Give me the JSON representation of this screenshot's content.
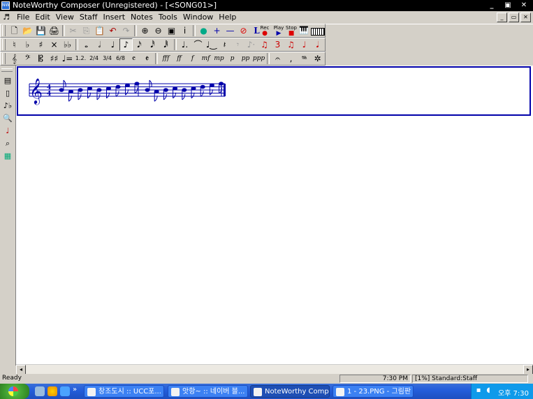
{
  "window": {
    "title": "NoteWorthy Composer (Unregistered) - [<SONG01>]",
    "app_icon_text": "NW",
    "minimize_glyph": "_",
    "restore_glyph": "▣",
    "close_glyph": "✕"
  },
  "menu": {
    "icon": "music-note-icon",
    "items": [
      "File",
      "Edit",
      "View",
      "Staff",
      "Insert",
      "Notes",
      "Tools",
      "Window",
      "Help"
    ],
    "mdi_minimize": "_",
    "mdi_restore": "▭",
    "mdi_close": "✕"
  },
  "toolbar1": {
    "buttons": [
      {
        "name": "new-doc-icon",
        "glyph": "🗋"
      },
      {
        "name": "open-folder-icon",
        "glyph": "📂"
      },
      {
        "name": "save-icon",
        "glyph": "💾"
      },
      {
        "name": "print-icon",
        "glyph": "🖨"
      },
      {
        "name": "cut-icon",
        "glyph": "✂"
      },
      {
        "name": "copy-icon",
        "glyph": "⎘"
      },
      {
        "name": "paste-icon",
        "glyph": "📋"
      },
      {
        "name": "undo-icon",
        "glyph": "↶"
      },
      {
        "name": "redo-icon",
        "glyph": "↷"
      },
      {
        "name": "zoom-in-icon",
        "glyph": "⊕"
      },
      {
        "name": "zoom-out-icon",
        "glyph": "⊖"
      },
      {
        "name": "staff-properties-icon",
        "glyph": "▣"
      },
      {
        "name": "info-icon",
        "glyph": "i"
      },
      {
        "name": "globe-icon",
        "glyph": "●"
      },
      {
        "name": "add-icon",
        "glyph": "+"
      },
      {
        "name": "remove-icon",
        "glyph": "—"
      },
      {
        "name": "stop-sign-icon",
        "glyph": "⊘"
      },
      {
        "name": "lyric-icon",
        "glyph": "L"
      }
    ],
    "rec_label": "Rec",
    "play_label": "Play",
    "stop_label": "Stop"
  },
  "toolbar2": {
    "buttons": [
      {
        "name": "natural-icon",
        "glyph": "♮"
      },
      {
        "name": "flat-icon",
        "glyph": "♭"
      },
      {
        "name": "sharp-icon",
        "glyph": "♯"
      },
      {
        "name": "double-sharp-icon",
        "glyph": "×"
      },
      {
        "name": "double-flat-icon",
        "glyph": "♭♭"
      },
      {
        "name": "whole-note-icon",
        "glyph": "𝅝"
      },
      {
        "name": "half-note-icon",
        "glyph": "𝅗𝅥"
      },
      {
        "name": "quarter-note-icon",
        "glyph": "♩"
      },
      {
        "name": "eighth-note-icon",
        "glyph": "♪"
      },
      {
        "name": "sixteenth-note-icon",
        "glyph": "𝅘𝅥𝅯"
      },
      {
        "name": "thirty-second-note-icon",
        "glyph": "𝅘𝅥𝅰"
      },
      {
        "name": "sixty-fourth-note-icon",
        "glyph": "𝅘𝅥𝅱"
      },
      {
        "name": "dotted-note-icon",
        "glyph": "♩."
      },
      {
        "name": "tie-icon",
        "glyph": "⌒"
      },
      {
        "name": "slur-icon",
        "glyph": "♩‿"
      },
      {
        "name": "rest-icon",
        "glyph": "𝄽"
      },
      {
        "name": "eighth-rest-icon",
        "glyph": "𝄾"
      },
      {
        "name": "staccato-icon",
        "glyph": "♪·"
      },
      {
        "name": "grace-note-icon",
        "glyph": "♫"
      },
      {
        "name": "triplet-icon",
        "glyph": "3"
      },
      {
        "name": "beam-icon",
        "glyph": "♫"
      },
      {
        "name": "stem-up-icon",
        "glyph": "♩"
      },
      {
        "name": "stem-down-icon",
        "glyph": "𝅘𝅥"
      }
    ]
  },
  "toolbar3": {
    "buttons": [
      {
        "name": "treble-clef-icon",
        "glyph": "𝄞"
      },
      {
        "name": "bass-clef-icon",
        "glyph": "𝄢"
      },
      {
        "name": "alto-clef-icon",
        "glyph": "𝄡"
      },
      {
        "name": "key-signature-icon",
        "glyph": "♯♯"
      },
      {
        "name": "tempo-icon",
        "glyph": "♩="
      },
      {
        "name": "ending-icon",
        "glyph": "1.2."
      },
      {
        "name": "time-sig-2-4-icon",
        "glyph": "2/4"
      },
      {
        "name": "time-sig-3-4-icon",
        "glyph": "3/4"
      },
      {
        "name": "time-sig-6-8-icon",
        "glyph": "6/8"
      },
      {
        "name": "common-time-icon",
        "glyph": "𝄴"
      },
      {
        "name": "cut-time-icon",
        "glyph": "𝄵"
      },
      {
        "name": "dynamic-fff-icon",
        "glyph": "fff"
      },
      {
        "name": "dynamic-ff-icon",
        "glyph": "ff"
      },
      {
        "name": "dynamic-f-icon",
        "glyph": "f"
      },
      {
        "name": "dynamic-mf-icon",
        "glyph": "mf"
      },
      {
        "name": "dynamic-mp-icon",
        "glyph": "mp"
      },
      {
        "name": "dynamic-p-icon",
        "glyph": "p"
      },
      {
        "name": "dynamic-pp-icon",
        "glyph": "pp"
      },
      {
        "name": "dynamic-ppp-icon",
        "glyph": "ppp"
      },
      {
        "name": "fermata-icon",
        "glyph": "𝄐"
      },
      {
        "name": "breath-mark-icon",
        "glyph": ","
      },
      {
        "name": "pedal-icon",
        "glyph": "𝆮"
      },
      {
        "name": "pedal-release-icon",
        "glyph": "✲"
      }
    ]
  },
  "left_toolbar": {
    "buttons": [
      {
        "name": "layer-icon",
        "glyph": "▤"
      },
      {
        "name": "book-icon",
        "glyph": "▯"
      },
      {
        "name": "transpose-icon",
        "glyph": "♪♭"
      },
      {
        "name": "print-preview-icon",
        "glyph": "🔍"
      },
      {
        "name": "note-color-icon",
        "glyph": "♩"
      },
      {
        "name": "find-icon",
        "glyph": "⌕"
      },
      {
        "name": "grid-view-icon",
        "glyph": "▦"
      }
    ]
  },
  "score": {
    "time_signature_top": "4",
    "time_signature_bottom": "4",
    "measure1_notes": [
      "A",
      "G",
      "A",
      "B",
      "A",
      "B",
      "C",
      "D",
      "E"
    ],
    "measure2_notes": [
      "A",
      "G",
      "A",
      "B",
      "A",
      "B",
      "C",
      "D",
      "E"
    ]
  },
  "status": {
    "ready": "Ready",
    "time": "7:30 PM",
    "staff_info": "[1%] Standard:Staff"
  },
  "taskbar": {
    "more_glyph": "»",
    "tasks": [
      {
        "label": "창조도시 :: UCC포...",
        "active": false
      },
      {
        "label": "앗항~ :: 네이버 블...",
        "active": false
      },
      {
        "label": "NoteWorthy Comp...",
        "active": true
      },
      {
        "label": "1 - 23.PNG - 그림판",
        "active": false
      }
    ],
    "clock": "오후 7:30"
  },
  "colors": {
    "staff_blue": "#0000aa",
    "taskbar_blue": "#245edb",
    "start_green": "#3c9a2e"
  }
}
